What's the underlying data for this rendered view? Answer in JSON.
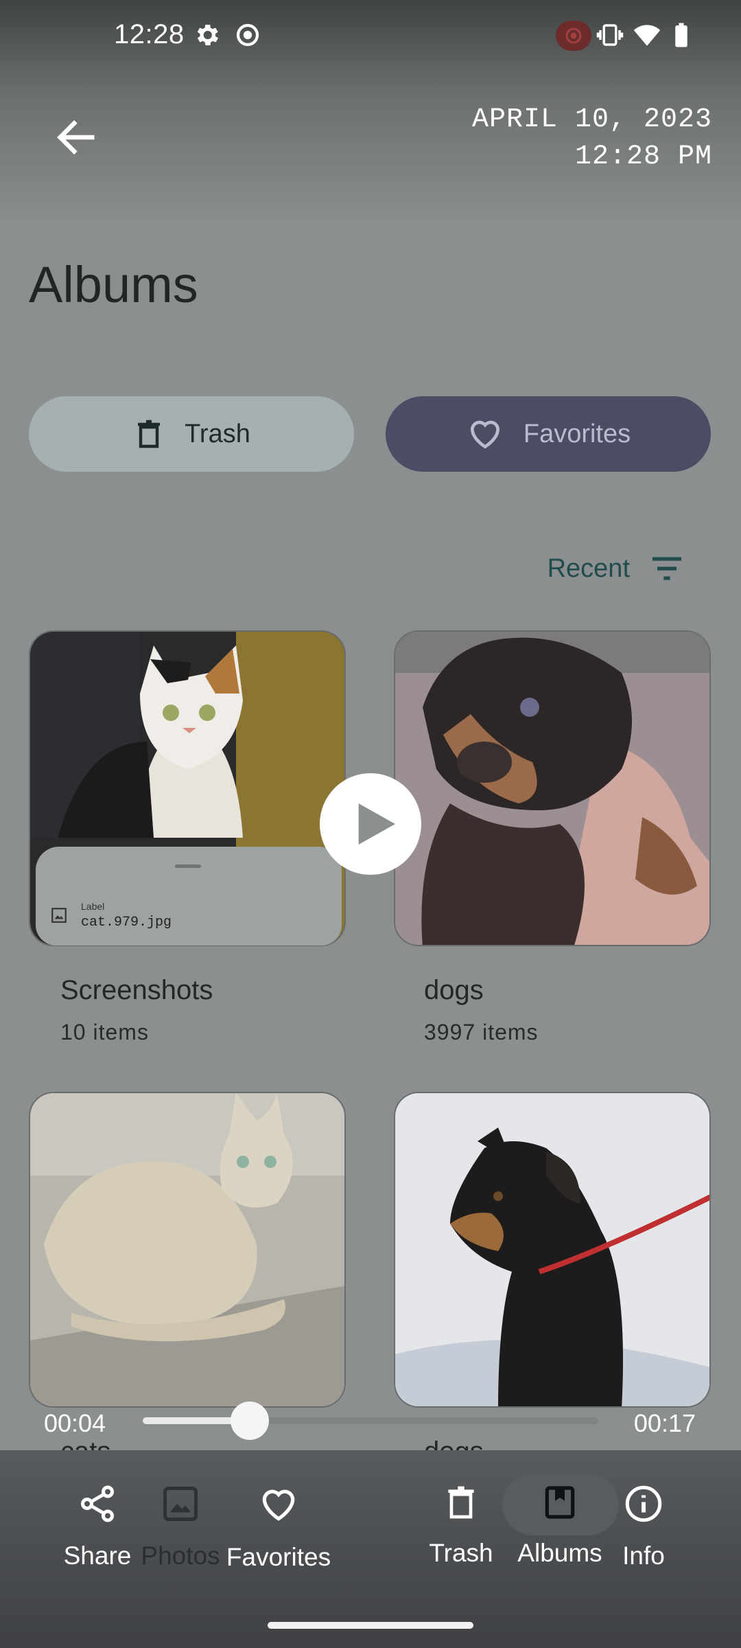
{
  "status_bar": {
    "time": "12:28"
  },
  "header": {
    "date": "APRIL 10, 2023",
    "time": "12:28 PM"
  },
  "page": {
    "title": "Albums"
  },
  "quick_buttons": {
    "trash": "Trash",
    "favorites": "Favorites"
  },
  "sort": {
    "label": "Recent"
  },
  "albums": [
    {
      "name": "Screenshots",
      "count": "10 items"
    },
    {
      "name": "dogs",
      "count": "3997 items"
    },
    {
      "name": "cats",
      "count": ""
    },
    {
      "name": "dogs",
      "count": ""
    }
  ],
  "label_card": {
    "small": "Label",
    "file": "cat.979.jpg"
  },
  "video": {
    "elapsed": "00:04",
    "total": "00:17",
    "progress": 0.235
  },
  "bottom_bar": {
    "share": "Share",
    "photos": "Photos",
    "favorites": "Favorites",
    "trash": "Trash",
    "albums": "Albums",
    "info": "Info"
  },
  "colors": {
    "accent": "#214c4d",
    "favorites_pill": "#4a4d63",
    "trash_pill": "#a6b0b0"
  }
}
